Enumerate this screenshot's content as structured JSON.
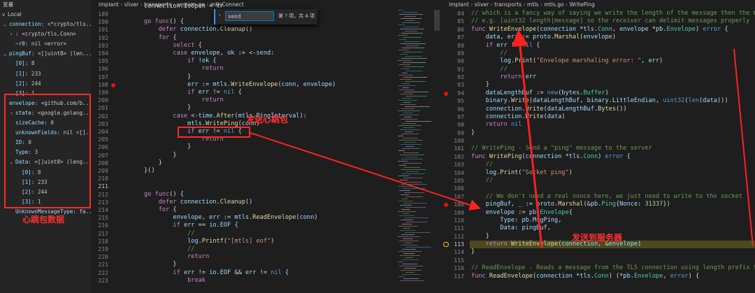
{
  "variables_panel": {
    "header": "变量",
    "section": "Local",
    "rows": [
      {
        "indent": 1,
        "chev": "v",
        "key": "connection",
        "val": "<*crypto/tls...",
        "type": "kv"
      },
      {
        "indent": 2,
        "chev": ">",
        "key": "",
        "val": ": <crypto/tls.Conn>",
        "type": "plain"
      },
      {
        "indent": 2,
        "chev": "",
        "key": "~r0",
        "val": "nil <error>",
        "type": "kv"
      },
      {
        "indent": 1,
        "chev": "v",
        "key": "pingBuf",
        "val": "<[]uint8> (len...",
        "type": "kv"
      },
      {
        "indent": 2,
        "chev": "",
        "key": "[0]",
        "val": "8",
        "type": "num"
      },
      {
        "indent": 2,
        "chev": "",
        "key": "[1]",
        "val": "233",
        "type": "num"
      },
      {
        "indent": 2,
        "chev": "",
        "key": "[2]",
        "val": "244",
        "type": "num"
      },
      {
        "indent": 2,
        "chev": "",
        "key": "[3]",
        "val": "1",
        "type": "num"
      },
      {
        "indent": 1,
        "chev": "v",
        "key": "envelope",
        "val": "<github.com/b...",
        "type": "kv"
      },
      {
        "indent": 2,
        "chev": ">",
        "key": "state",
        "val": "<google.golang...",
        "type": "kv"
      },
      {
        "indent": 2,
        "chev": "",
        "key": "sizeCache",
        "val": "0",
        "type": "num"
      },
      {
        "indent": 2,
        "chev": "",
        "key": "unknownFields",
        "val": "nil <[]...",
        "type": "kv"
      },
      {
        "indent": 2,
        "chev": "",
        "key": "ID",
        "val": "0",
        "type": "num"
      },
      {
        "indent": 2,
        "chev": "",
        "key": "Type",
        "val": "3",
        "type": "num"
      },
      {
        "indent": 2,
        "chev": "v",
        "key": "Data",
        "val": "<[]uint8> (leng...",
        "type": "kv"
      },
      {
        "indent": 3,
        "chev": "",
        "key": "[0]",
        "val": "8",
        "type": "num"
      },
      {
        "indent": 3,
        "chev": "",
        "key": "[1]",
        "val": "233",
        "type": "num"
      },
      {
        "indent": 3,
        "chev": "",
        "key": "[2]",
        "val": "244",
        "type": "num"
      },
      {
        "indent": 3,
        "chev": "",
        "key": "[3]",
        "val": "1",
        "type": "num"
      },
      {
        "indent": 2,
        "chev": "",
        "key": "UnknownMessageType",
        "val": "fa...",
        "type": "kv"
      }
    ],
    "annotation": "心跳包数据"
  },
  "left_editor": {
    "breadcrumb": [
      "implant",
      "sliver",
      "transports",
      "session.go",
      "mtlsConnect"
    ],
    "find_widget": {
      "value": "send",
      "result": "第 ? 项，共 4 项"
    },
    "annotation": "发送心跳包",
    "first_line": "connection.IsOpen = tr",
    "lines": [
      {
        "n": 189,
        "t": ""
      },
      {
        "n": 190,
        "t": "go func() {"
      },
      {
        "n": 191,
        "t": "    defer connection.Cleanup()"
      },
      {
        "n": 192,
        "t": "    for {"
      },
      {
        "n": 193,
        "t": "        select {"
      },
      {
        "n": 194,
        "t": "        case envelope, ok := <-send:"
      },
      {
        "n": 195,
        "t": "            if !ok {"
      },
      {
        "n": 196,
        "t": "                return"
      },
      {
        "n": 197,
        "t": "            }"
      },
      {
        "n": 198,
        "t": "            err := mtls.WriteEnvelope(conn, envelope)"
      },
      {
        "n": 199,
        "t": "            if err != nil {"
      },
      {
        "n": 200,
        "t": "                return"
      },
      {
        "n": 201,
        "t": "            }"
      },
      {
        "n": 202,
        "t": "        case <-time.After(mtls.PingInterval):"
      },
      {
        "n": 203,
        "t": "            mtls.WritePing(conn)"
      },
      {
        "n": 204,
        "t": "            if err != nil {"
      },
      {
        "n": 205,
        "t": "                return"
      },
      {
        "n": 206,
        "t": "            }"
      },
      {
        "n": 207,
        "t": "        }"
      },
      {
        "n": 208,
        "t": "    }"
      },
      {
        "n": 209,
        "t": "}()"
      },
      {
        "n": 210,
        "t": ""
      },
      {
        "n": 211,
        "t": ""
      },
      {
        "n": 212,
        "t": "go func() {"
      },
      {
        "n": 213,
        "t": "    defer connection.Cleanup()"
      },
      {
        "n": 214,
        "t": "    for {"
      },
      {
        "n": 215,
        "t": "        envelope, err := mtls.ReadEnvelope(conn)"
      },
      {
        "n": 216,
        "t": "        if err == io.EOF {"
      },
      {
        "n": 217,
        "t": "            //"
      },
      {
        "n": 218,
        "t": "            log.Printf(\"[mtls] eof\")"
      },
      {
        "n": 219,
        "t": "            //"
      },
      {
        "n": 220,
        "t": "            return"
      },
      {
        "n": 221,
        "t": "        }"
      },
      {
        "n": 222,
        "t": "        if err != io.EOF && err != nil {"
      },
      {
        "n": 223,
        "t": "            break"
      }
    ]
  },
  "right_editor": {
    "breadcrumb": [
      "implant",
      "sliver",
      "transports",
      "mtls",
      "mtls.go",
      "WritePing"
    ],
    "annotation": "发送到服务器",
    "lines": [
      {
        "n": 84,
        "t": "// which is a fancy way of saying we write the length of the message then the message"
      },
      {
        "n": 85,
        "t": "// e.g. [uint32 length|message] so the receiver can delimit messages properly"
      },
      {
        "n": 86,
        "t": "func WriteEnvelope(connection *tls.Conn, envelope *pb.Envelope) error {"
      },
      {
        "n": 87,
        "t": "    data, err := proto.Marshal(envelope)"
      },
      {
        "n": 88,
        "t": "    if err != nil {"
      },
      {
        "n": 89,
        "t": "        //"
      },
      {
        "n": 90,
        "t": "        log.Print(\"Envelope marshaling error: \", err)"
      },
      {
        "n": 91,
        "t": "        //"
      },
      {
        "n": 92,
        "t": "        return err"
      },
      {
        "n": 93,
        "t": "    }"
      },
      {
        "n": 94,
        "t": "    dataLengthBuf := new(bytes.Buffer)"
      },
      {
        "n": 95,
        "t": "    binary.Write(dataLengthBuf, binary.LittleEndian, uint32(len(data)))"
      },
      {
        "n": 96,
        "t": "    connection.Write(dataLengthBuf.Bytes())"
      },
      {
        "n": 97,
        "t": "    connection.Write(data)"
      },
      {
        "n": 98,
        "t": "    return nil"
      },
      {
        "n": 99,
        "t": "}"
      },
      {
        "n": 100,
        "t": ""
      },
      {
        "n": 101,
        "t": "// WritePing - Send a \"ping\" message to the server"
      },
      {
        "n": 102,
        "t": "func WritePing(connection *tls.Conn) error {"
      },
      {
        "n": 103,
        "t": "    //"
      },
      {
        "n": 104,
        "t": "    log.Print(\"Socket ping\")"
      },
      {
        "n": 105,
        "t": "    //"
      },
      {
        "n": 106,
        "t": ""
      },
      {
        "n": 107,
        "t": "    // We don't need a real nonce here, we just need to write to the socket"
      },
      {
        "n": 108,
        "t": "    pingBuf, _ := proto.Marshal(&pb.Ping{Nonce: 31337})"
      },
      {
        "n": 109,
        "t": "    envelope := pb.Envelope{"
      },
      {
        "n": 110,
        "t": "        Type: pb.MsgPing,"
      },
      {
        "n": 111,
        "t": "        Data: pingBuf,"
      },
      {
        "n": 112,
        "t": "    }"
      },
      {
        "n": 113,
        "t": "    return WriteEnvelope(connection, &envelope)"
      },
      {
        "n": 114,
        "t": "}"
      },
      {
        "n": 115,
        "t": ""
      },
      {
        "n": 116,
        "t": "// ReadEnvelope - Reads a message from the TLS connection using length prefix framing"
      },
      {
        "n": 117,
        "t": "func ReadEnvelope(connection *tls.Conn) (*pb.Envelope, error) {"
      }
    ]
  },
  "colors": {
    "annotation_red": "#ff2a2a",
    "current_line": "#4a4a1e",
    "accent": "#007acc"
  }
}
